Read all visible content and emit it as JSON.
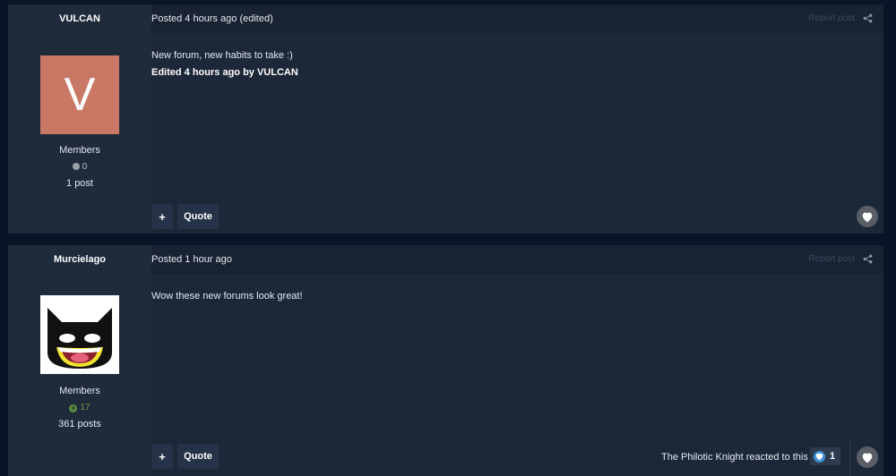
{
  "posts": [
    {
      "author": "VULCAN",
      "avatar_letter": "V",
      "avatar_color": "#c97866",
      "group": "Members",
      "reputation": "0",
      "post_count": "1 post",
      "posted": "Posted 4 hours ago (edited)",
      "report_label": "Report post",
      "content": "New forum, new habits to take :)",
      "edited_note": "Edited 4 hours ago by VULCAN",
      "plus_label": "+",
      "quote_label": "Quote"
    },
    {
      "author": "Murcielago",
      "group": "Members",
      "reputation": "17",
      "post_count": "361 posts",
      "posted": "Posted 1 hour ago",
      "report_label": "Report post",
      "content": "Wow these new forums look great!",
      "plus_label": "+",
      "quote_label": "Quote",
      "reaction_text": "The Philotic Knight reacted to this",
      "reaction_count": "1"
    }
  ],
  "icons": {
    "share": "share-icon",
    "like": "heart-icon",
    "reputation_neutral": "dot-icon",
    "reputation_positive": "plus-circle-icon",
    "reaction": "heart-reaction-icon"
  }
}
